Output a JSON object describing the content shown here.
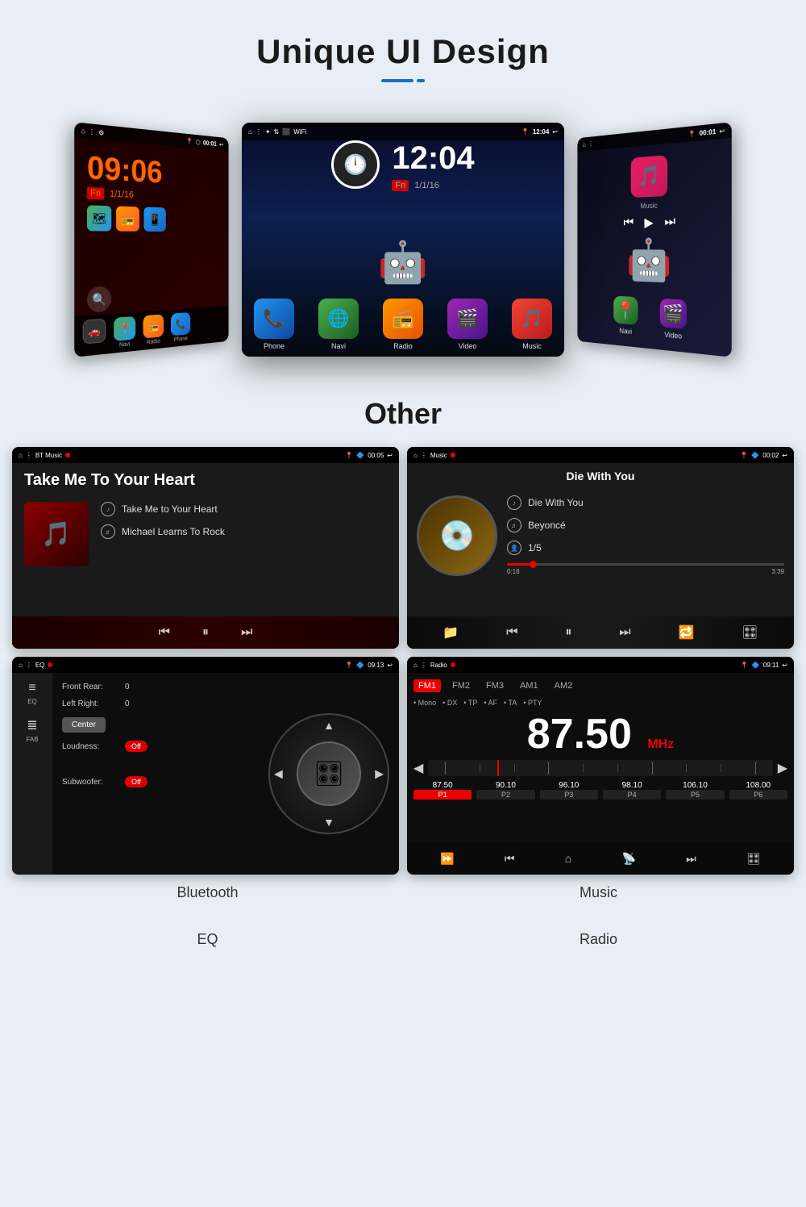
{
  "header": {
    "title": "Unique UI Design",
    "underline_long": "—",
    "underline_short": "·"
  },
  "center_screen": {
    "status_bar": {
      "time": "12:04",
      "icons_left": [
        "home",
        "menu",
        "settings",
        "share",
        "image",
        "wifi"
      ],
      "icons_right": [
        "location",
        "12:04",
        "back"
      ]
    },
    "clock_display": "12:04",
    "date_display": "1/1/16",
    "day_display": "Fri",
    "apps": [
      {
        "label": "Phone",
        "icon": "📞"
      },
      {
        "label": "Navi",
        "icon": "🌐"
      },
      {
        "label": "Radio",
        "icon": "📻"
      },
      {
        "label": "Video",
        "icon": "🎬"
      },
      {
        "label": "Music",
        "icon": "🎵"
      }
    ]
  },
  "other_section": {
    "title": "Other"
  },
  "bt_music": {
    "status_left": "BT Music",
    "status_time": "00:05",
    "title": "Take Me To Your Heart",
    "track_name": "Take Me to Your Heart",
    "artist": "Michael Learns To Rock",
    "controls": [
      "prev",
      "pause",
      "next"
    ],
    "label": "Bluetooth"
  },
  "music_screen": {
    "status_left": "Music",
    "status_time": "00:02",
    "title": "Die With You",
    "track_name": "Die With You",
    "artist": "Beyoncé",
    "track_num": "1/5",
    "progress_current": "0:18",
    "progress_total": "3:39",
    "label": "Music"
  },
  "eq_screen": {
    "status_left": "EQ",
    "status_time": "09:13",
    "sidebar_items": [
      {
        "icon": "≡",
        "label": "EQ"
      },
      {
        "icon": "≣",
        "label": "FAB"
      }
    ],
    "front_rear": "0",
    "left_right": "0",
    "center_label": "Center",
    "loudness_label": "Loudness:",
    "loudness_state": "Off",
    "subwoofer_label": "Subwoofer:",
    "subwoofer_state": "Off",
    "label": "EQ"
  },
  "radio_screen": {
    "status_left": "Radio",
    "status_time": "09:11",
    "bands": [
      "FM1",
      "FM2",
      "FM3",
      "AM1",
      "AM2"
    ],
    "active_band": "FM1",
    "options": [
      "Mono",
      "DX",
      "TP",
      "AF",
      "TA",
      "PTY"
    ],
    "frequency": "87.50",
    "unit": "MHz",
    "presets": [
      {
        "freq": "87.50",
        "label": "P1",
        "active": true
      },
      {
        "freq": "90.10",
        "label": "P2",
        "active": false
      },
      {
        "freq": "96.10",
        "label": "P3",
        "active": false
      },
      {
        "freq": "98.10",
        "label": "P4",
        "active": false
      },
      {
        "freq": "106.10",
        "label": "P5",
        "active": false
      },
      {
        "freq": "108.00",
        "label": "P6",
        "active": false
      }
    ],
    "label": "Radio"
  }
}
